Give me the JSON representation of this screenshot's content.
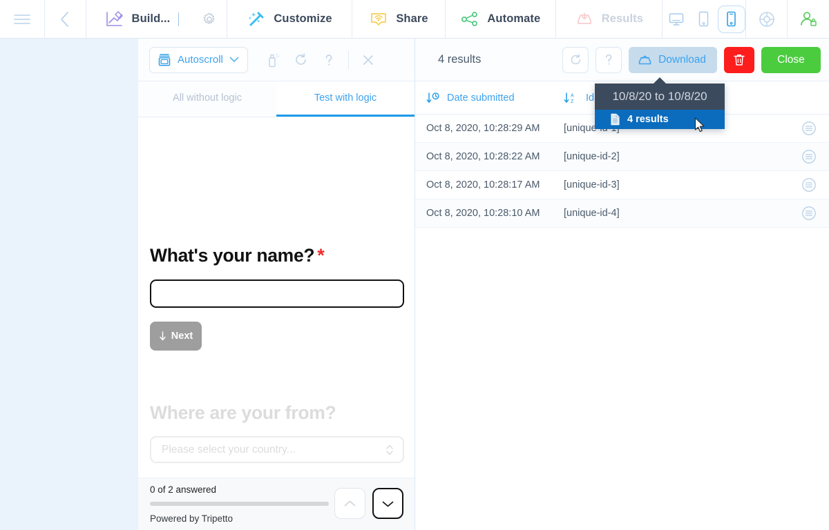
{
  "topbar": {
    "items": [
      {
        "name": "hamburger",
        "label": ""
      },
      {
        "name": "back",
        "label": ""
      },
      {
        "name": "build",
        "label": "Build..."
      },
      {
        "name": "customize",
        "label": "Customize"
      },
      {
        "name": "share",
        "label": "Share"
      },
      {
        "name": "automate",
        "label": "Automate"
      },
      {
        "name": "results",
        "label": "Results"
      }
    ],
    "build_label": "Build...",
    "customize_label": "Customize",
    "share_label": "Share",
    "automate_label": "Automate",
    "results_label": "Results",
    "devices": [
      {
        "icon": "desktop-icon",
        "active": false
      },
      {
        "icon": "tablet-icon",
        "active": false
      },
      {
        "icon": "mobile-icon",
        "active": true
      }
    ],
    "help_icon": "lifebuoy-icon",
    "account_icon": "user-lock-icon"
  },
  "preview": {
    "toolbar": {
      "autoscroll_label": "Autoscroll",
      "autoscroll_icon": "autoscroll-icon",
      "chevron_icon": "chevron-down-icon",
      "clean_icon": "spray-icon",
      "restart_icon": "refresh-icon",
      "help_icon": "question-icon",
      "close_icon": "close-icon"
    },
    "tabs": [
      {
        "label": "All without logic",
        "active": false
      },
      {
        "label": "Test with logic",
        "active": true
      }
    ],
    "questions": [
      {
        "title": "What's your name?",
        "required": true,
        "required_mark": "*",
        "input_value": "",
        "next_label": "Next",
        "next_icon": "arrow-down-icon"
      },
      {
        "title": "Where are your from?",
        "required": false,
        "select_placeholder": "Please select your country...",
        "select_icon": "chevron-updown-icon"
      }
    ],
    "footer": {
      "answered_text": "0 of 2 answered",
      "progress_percent": 0,
      "powered_by": "Powered by Tripetto",
      "prev_icon": "chevron-up-icon",
      "next_icon": "chevron-down-icon"
    }
  },
  "results": {
    "header": {
      "count_label": "4 results",
      "refresh_icon": "refresh-icon",
      "help_icon": "question-icon",
      "download_label": "Download",
      "download_icon": "download-icon",
      "delete_icon": "trash-icon",
      "close_label": "Close"
    },
    "columns": [
      {
        "label": "Date submitted",
        "sort_icon": "sort-by-date-icon"
      },
      {
        "label": "Identifier",
        "sort_icon": "sort-az-icon"
      }
    ],
    "rows": [
      {
        "date": "Oct 8, 2020, 10:28:29 AM",
        "identifier": "[unique-id-1]",
        "menu_icon": "row-menu-icon"
      },
      {
        "date": "Oct 8, 2020, 10:28:22 AM",
        "identifier": "[unique-id-2]",
        "menu_icon": "row-menu-icon"
      },
      {
        "date": "Oct 8, 2020, 10:28:17 AM",
        "identifier": "[unique-id-3]",
        "menu_icon": "row-menu-icon"
      },
      {
        "date": "Oct 8, 2020, 10:28:10 AM",
        "identifier": "[unique-id-4]",
        "menu_icon": "row-menu-icon"
      }
    ]
  },
  "download_menu": {
    "header_label": "10/8/20 to 10/8/20",
    "item_label": "4 results",
    "item_icon": "file-icon"
  },
  "colors": {
    "accent_blue": "#3da2ee",
    "header_dark": "#3c4a5d",
    "menu_blue": "#0b6cbd",
    "danger_red": "#fd1d1d",
    "success_green": "#4bcc3f",
    "download_bg": "#c6dced",
    "left_backdrop": "#eaf2fc"
  }
}
